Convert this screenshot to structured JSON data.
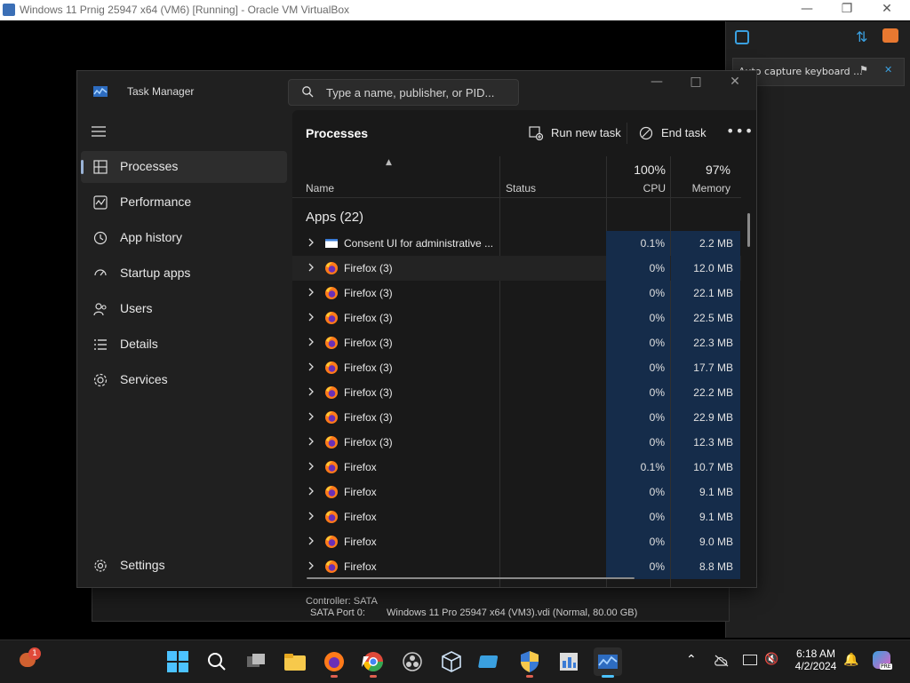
{
  "host": {
    "window_title": "Windows 11 Prnig 25947 x64 (VM6) [Running] - Oracle VM VirtualBox",
    "notification_text": "Auto capture keyboard ..."
  },
  "task_manager": {
    "title": "Task Manager",
    "search_placeholder": "Type a name, publisher, or PID...",
    "nav": [
      {
        "label": "Processes",
        "icon": "processes-icon",
        "active": true
      },
      {
        "label": "Performance",
        "icon": "performance-icon"
      },
      {
        "label": "App history",
        "icon": "app-history-icon"
      },
      {
        "label": "Startup apps",
        "icon": "startup-apps-icon"
      },
      {
        "label": "Users",
        "icon": "users-icon"
      },
      {
        "label": "Details",
        "icon": "details-icon"
      },
      {
        "label": "Services",
        "icon": "services-icon"
      }
    ],
    "settings_label": "Settings",
    "page_title": "Processes",
    "toolbar": {
      "run_new_task": "Run new task",
      "end_task": "End task"
    },
    "columns": {
      "name": "Name",
      "status": "Status",
      "cpu_pct": "100%",
      "cpu": "CPU",
      "mem_pct": "97%",
      "memory": "Memory"
    },
    "group_label": "Apps (22)",
    "rows": [
      {
        "name": "Consent UI for administrative ...",
        "icon": "window-icon",
        "cpu": "0.1%",
        "mem": "2.2 MB"
      },
      {
        "name": "Firefox (3)",
        "icon": "firefox-icon",
        "cpu": "0%",
        "mem": "12.0 MB"
      },
      {
        "name": "Firefox (3)",
        "icon": "firefox-icon",
        "cpu": "0%",
        "mem": "22.1 MB"
      },
      {
        "name": "Firefox (3)",
        "icon": "firefox-icon",
        "cpu": "0%",
        "mem": "22.5 MB"
      },
      {
        "name": "Firefox (3)",
        "icon": "firefox-icon",
        "cpu": "0%",
        "mem": "22.3 MB"
      },
      {
        "name": "Firefox (3)",
        "icon": "firefox-icon",
        "cpu": "0%",
        "mem": "17.7 MB"
      },
      {
        "name": "Firefox (3)",
        "icon": "firefox-icon",
        "cpu": "0%",
        "mem": "22.2 MB"
      },
      {
        "name": "Firefox (3)",
        "icon": "firefox-icon",
        "cpu": "0%",
        "mem": "22.9 MB"
      },
      {
        "name": "Firefox (3)",
        "icon": "firefox-icon",
        "cpu": "0%",
        "mem": "12.3 MB"
      },
      {
        "name": "Firefox",
        "icon": "firefox-icon",
        "cpu": "0.1%",
        "mem": "10.7 MB"
      },
      {
        "name": "Firefox",
        "icon": "firefox-icon",
        "cpu": "0%",
        "mem": "9.1 MB"
      },
      {
        "name": "Firefox",
        "icon": "firefox-icon",
        "cpu": "0%",
        "mem": "9.1 MB"
      },
      {
        "name": "Firefox",
        "icon": "firefox-icon",
        "cpu": "0%",
        "mem": "9.0 MB"
      },
      {
        "name": "Firefox",
        "icon": "firefox-icon",
        "cpu": "0%",
        "mem": "8.8 MB"
      }
    ]
  },
  "background_window": {
    "controller": "Controller: SATA",
    "port_label": "SATA Port 0:",
    "port_value": "Windows 11 Pro 25947 x64 (VM3).vdi (Normal, 80.00 GB)"
  },
  "taskbar": {
    "time": "6:18 AM",
    "date": "4/2/2024",
    "weather_badge": "1",
    "copilot_badge": "PRE"
  },
  "colors": {
    "accent": "#9ab3d6",
    "cpu_mem_highlight": "#152c4a",
    "window_bg": "#202020",
    "content_bg": "#191919"
  }
}
